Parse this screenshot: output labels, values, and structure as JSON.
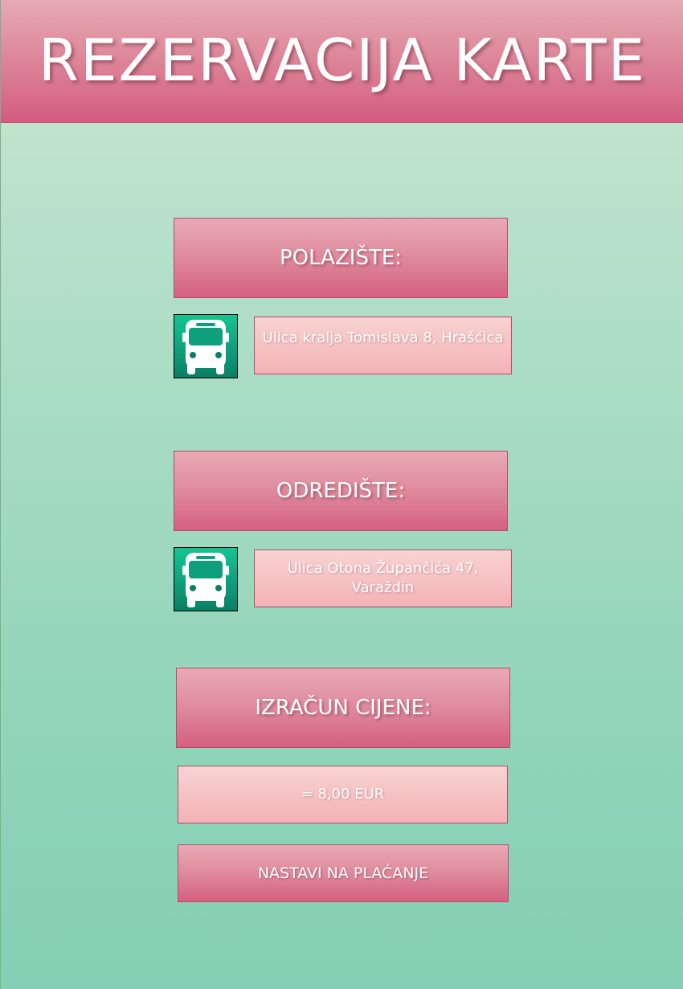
{
  "header": {
    "title": "REZERVACIJA KARTE"
  },
  "departure": {
    "label": "POLAZIŠTE:",
    "address": "Ulica kralja Tomislava 8, Hrašćica",
    "icon": "bus-icon"
  },
  "destination": {
    "label": "ODREDIŠTE:",
    "address": "Ulica Otona Župančića 47, Varaždin",
    "icon": "bus-icon"
  },
  "price": {
    "label": "IZRAČUN CIJENE:",
    "value": "= 8,00 EUR"
  },
  "actions": {
    "continue_label": "NASTAVI NA PLAĆANJE"
  },
  "colors": {
    "header_pink": "#d35c80",
    "box_pink": "#f6c2c4",
    "icon_green": "#0ea07c",
    "background_green": "#8fd4b9"
  }
}
